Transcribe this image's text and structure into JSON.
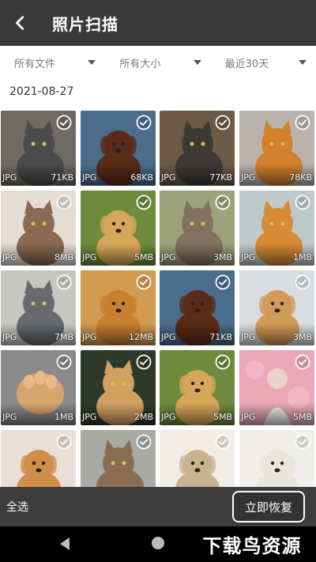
{
  "header": {
    "title": "照片扫描",
    "back_icon": "chevron-left-icon"
  },
  "filters": [
    {
      "label": "所有文件"
    },
    {
      "label": "所有大小"
    },
    {
      "label": "最近30天"
    }
  ],
  "date_group": "2021-08-27",
  "photos": [
    {
      "type": "JPG",
      "size": "71KB",
      "bg": "#6f6a63",
      "fg": "#4b4b4b",
      "animal": "cat"
    },
    {
      "type": "JPG",
      "size": "68KB",
      "bg": "#4a6d8c",
      "fg": "#5a2b17",
      "animal": "dog"
    },
    {
      "type": "JPG",
      "size": "77KB",
      "bg": "#6d5a45",
      "fg": "#3d3a36",
      "animal": "cat"
    },
    {
      "type": "JPG",
      "size": "78KB",
      "bg": "#b9b2ad",
      "fg": "#d2802d",
      "animal": "cat"
    },
    {
      "type": "JPG",
      "size": "8MB",
      "bg": "#e4ddd6",
      "fg": "#8a6a52",
      "animal": "cat"
    },
    {
      "type": "JPG",
      "size": "5MB",
      "bg": "#6e8a3c",
      "fg": "#d8a659",
      "animal": "dog"
    },
    {
      "type": "JPG",
      "size": "3MB",
      "bg": "#9ca37a",
      "fg": "#827160",
      "animal": "cat"
    },
    {
      "type": "JPG",
      "size": "1MB",
      "bg": "#bfc9c9",
      "fg": "#d68a36",
      "animal": "cat"
    },
    {
      "type": "JPG",
      "size": "7MB",
      "bg": "#c7c7c2",
      "fg": "#666a6e",
      "animal": "cat"
    },
    {
      "type": "JPG",
      "size": "12MB",
      "bg": "#d29b4e",
      "fg": "#c7802f",
      "animal": "dog"
    },
    {
      "type": "JPG",
      "size": "71KB",
      "bg": "#4a6d8c",
      "fg": "#5a2b17",
      "animal": "dog"
    },
    {
      "type": "JPG",
      "size": "3MB",
      "bg": "#d9dde0",
      "fg": "#d29a57",
      "animal": "dog"
    },
    {
      "type": "JPG",
      "size": "1MB",
      "bg": "#8a8a8a",
      "fg": "#d7a46d",
      "animal": "paw"
    },
    {
      "type": "JPG",
      "size": "2MB",
      "bg": "#2d3a2b",
      "fg": "#d2a060",
      "animal": "cat"
    },
    {
      "type": "JPG",
      "size": "5MB",
      "bg": "#6e8a3c",
      "fg": "#d8a659",
      "animal": "dog"
    },
    {
      "type": "JPG",
      "size": "5MB",
      "bg": "#e9a7b8",
      "fg": "#e9d2c6",
      "animal": "person"
    },
    {
      "type": "",
      "size": "",
      "bg": "#e8dfd7",
      "fg": "#cf8d4a",
      "animal": "dog"
    },
    {
      "type": "",
      "size": "",
      "bg": "#a9aaa4",
      "fg": "#8a6c53",
      "animal": "cat"
    },
    {
      "type": "",
      "size": "",
      "bg": "#f1ede6",
      "fg": "#c9b38f",
      "animal": "dog"
    },
    {
      "type": "",
      "size": "",
      "bg": "#f0efeb",
      "fg": "#e9e5dc",
      "animal": "dog"
    }
  ],
  "bottom_bar": {
    "select_all": "全选",
    "recover": "立即恢复"
  },
  "nav": {
    "back_icon": "triangle-back-icon",
    "home_icon": "circle-home-icon"
  },
  "watermark": "下载鸟资源"
}
